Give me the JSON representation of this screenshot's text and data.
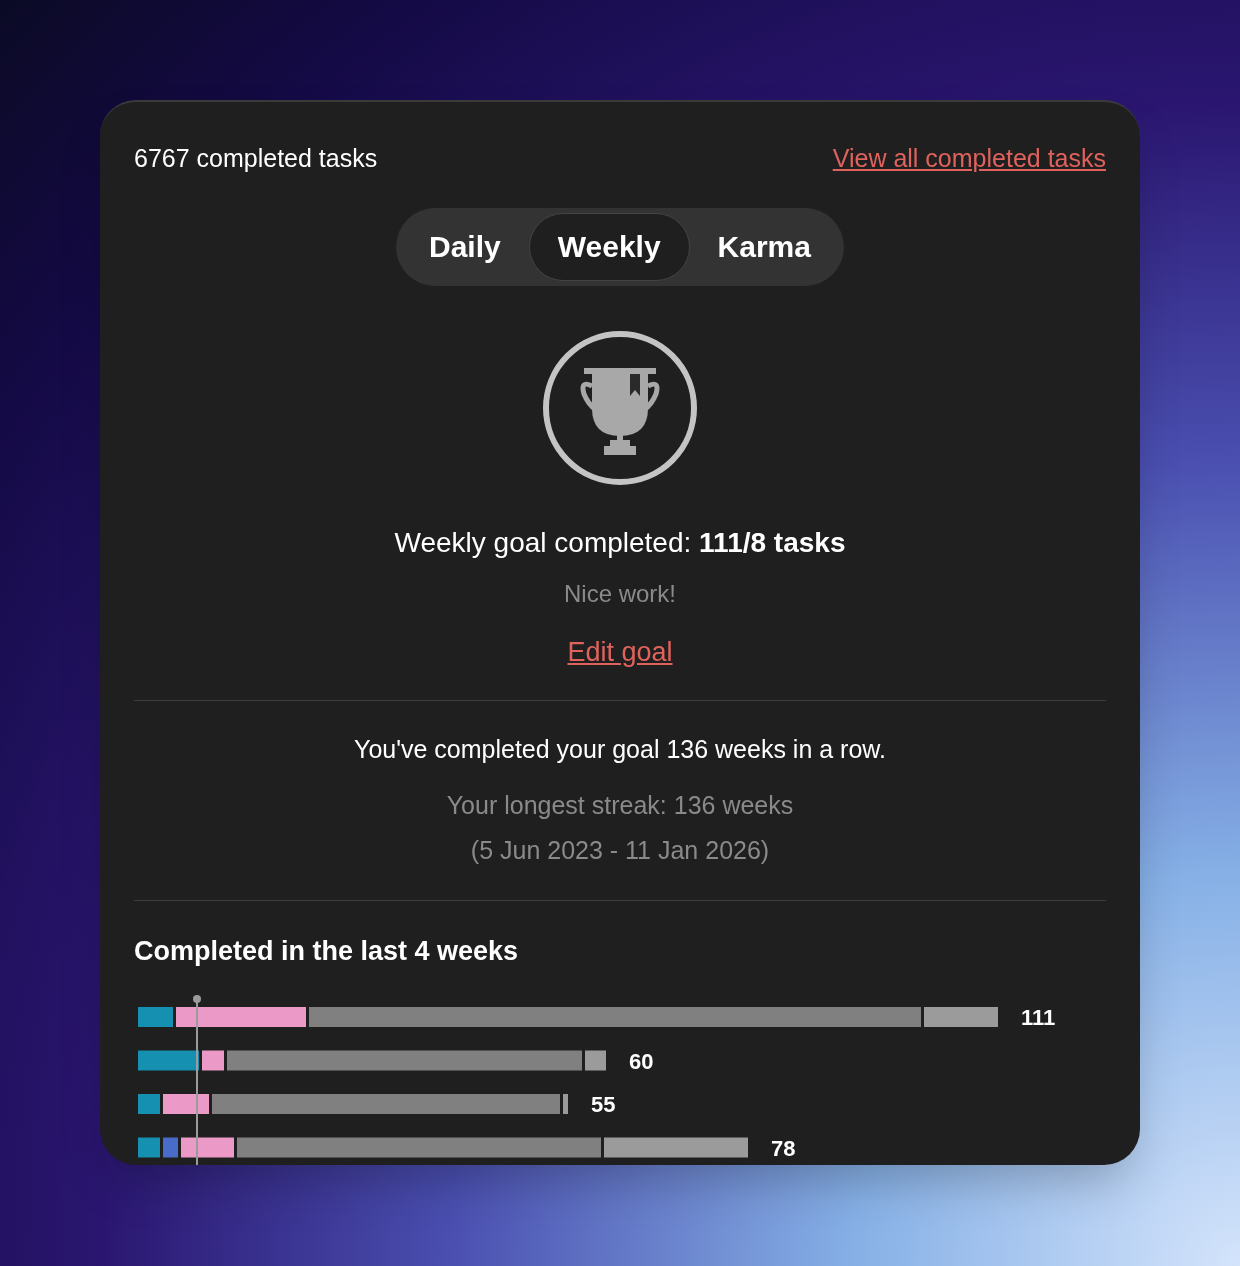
{
  "header": {
    "completed_count": "6767 completed tasks",
    "view_all_link": "View all completed tasks"
  },
  "tabs": [
    {
      "label": "Daily",
      "selected": false
    },
    {
      "label": "Weekly",
      "selected": true
    },
    {
      "label": "Karma",
      "selected": false
    }
  ],
  "goal": {
    "status": "Weekly goal completed: **111/8 tasks**",
    "message": "Nice work!",
    "edit_link": "Edit goal"
  },
  "streak": {
    "current": "You've completed your goal 136 weeks in a row.",
    "longest": "Your longest streak: 136 weeks",
    "range": "(5 Jun 2023 - 11 Jan 2026)"
  },
  "recent": {
    "title": "Completed in the last 4 weeks",
    "totals": [
      "111",
      "60",
      "55",
      "78"
    ]
  }
}
